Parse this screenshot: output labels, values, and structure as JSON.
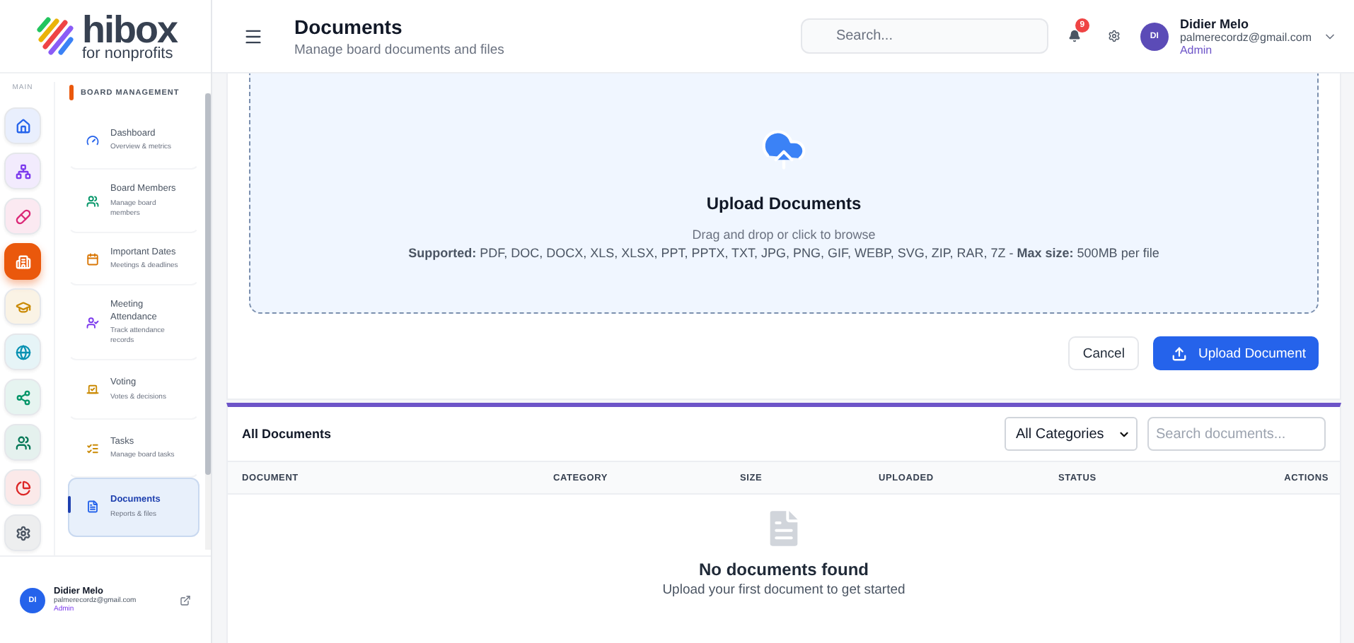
{
  "brand": {
    "name": "hibox",
    "tagline": "for nonprofits"
  },
  "rail": {
    "label": "MAIN",
    "items": [
      {
        "kind": "home",
        "color": "#2563eb",
        "selected": false
      },
      {
        "kind": "org",
        "color": "#7c3aed",
        "selected": false
      },
      {
        "kind": "pill",
        "color": "#db2777",
        "selected": false
      },
      {
        "kind": "building",
        "color": "#ea580c",
        "selected": true
      },
      {
        "kind": "cap",
        "color": "#ca8a04",
        "selected": false
      },
      {
        "kind": "globe",
        "color": "#0891b2",
        "selected": false
      },
      {
        "kind": "share",
        "color": "#059669",
        "selected": false
      },
      {
        "kind": "users",
        "color": "#047857",
        "selected": false
      },
      {
        "kind": "pie",
        "color": "#dc2626",
        "selected": false
      },
      {
        "kind": "gear",
        "color": "#4b5563",
        "selected": false
      }
    ]
  },
  "submenu": {
    "title": "BOARD MANAGEMENT",
    "items": [
      {
        "kind": "dashboard",
        "label": "Dashboard",
        "hint": "Overview & metrics",
        "selected": false
      },
      {
        "kind": "members",
        "label": "Board Members",
        "hint": "Manage board members",
        "selected": false
      },
      {
        "kind": "dates",
        "label": "Important Dates",
        "hint": "Meetings & deadlines",
        "selected": false
      },
      {
        "kind": "attendance",
        "label": "Meeting Attendance",
        "hint": "Track attendance records",
        "selected": false
      },
      {
        "kind": "voting",
        "label": "Voting",
        "hint": "Votes & decisions",
        "selected": false
      },
      {
        "kind": "tasks",
        "label": "Tasks",
        "hint": "Manage board tasks",
        "selected": false
      },
      {
        "kind": "documents",
        "label": "Documents",
        "hint": "Reports & files",
        "selected": true
      }
    ]
  },
  "sidebar_user": {
    "initials": "DI",
    "name": "Didier Melo",
    "email": "palmerecordz@gmail.com",
    "role": "Admin"
  },
  "header": {
    "title": "Documents",
    "subtitle": "Manage board documents and files",
    "search": {
      "placeholder": "Search..."
    },
    "notifications": "9",
    "user": {
      "initials": "DI",
      "name": "Didier Melo",
      "email": "palmerecordz@gmail.com",
      "role": "Admin"
    }
  },
  "upload": {
    "title": "Upload Documents",
    "hint": "Drag and drop or click to browse",
    "supported": "**Supported:** PDF, DOC, DOCX, XLS, XLSX, PPT, PPTX, TXT, JPG, PNG, GIF, WEBP, SVG, ZIP, RAR, 7Z - **Max size:** 500MB per file",
    "buttons": [
      {
        "kind": "secondary",
        "label": "Cancel"
      },
      {
        "kind": "primary",
        "label": "Upload Document"
      }
    ]
  },
  "documents": {
    "title": "All Documents",
    "category_filter": "All Categories",
    "search": {
      "placeholder": "Search documents..."
    },
    "columns": [
      "DOCUMENT",
      "CATEGORY",
      "SIZE",
      "UPLOADED",
      "STATUS",
      "ACTIONS"
    ],
    "empty": {
      "title": "No documents found",
      "hint": "Upload your first document to get started"
    }
  }
}
